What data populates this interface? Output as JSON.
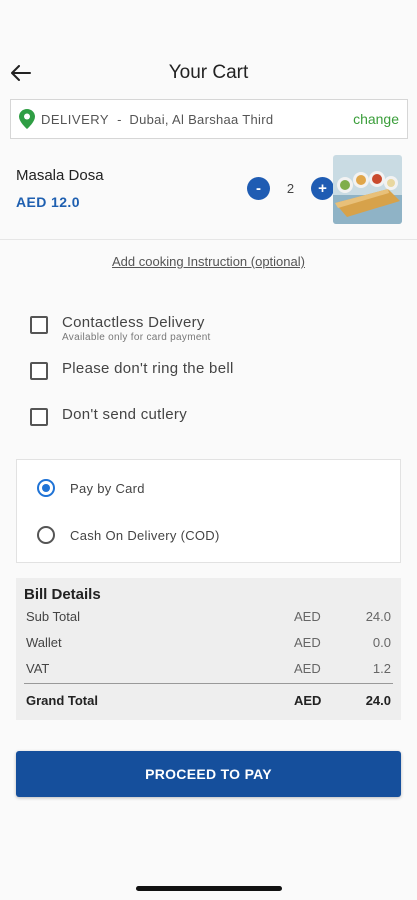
{
  "header": {
    "title": "Your Cart",
    "back_icon": "arrow-left-icon"
  },
  "address": {
    "type": "DELIVERY",
    "separator": "-",
    "location": "Dubai, Al Barshaa Third",
    "change_label": "change",
    "pin_color": "#2f9e44"
  },
  "cart": {
    "items": [
      {
        "name": "Masala Dosa",
        "price": "AED 12.0",
        "minus": "-",
        "quantity": "2",
        "plus": "+"
      }
    ]
  },
  "instructions": {
    "label": "Add cooking Instruction (optional)"
  },
  "options": {
    "contactless": {
      "label": "Contactless Delivery",
      "sublabel": "Available only for card payment",
      "checked": false
    },
    "no_bell": {
      "label": "Please don't ring the bell",
      "checked": false
    },
    "no_cutlery": {
      "label": "Don't send cutlery",
      "checked": false
    }
  },
  "payment": {
    "options": [
      {
        "label": "Pay by Card",
        "selected": true
      },
      {
        "label": "Cash On Delivery (COD)",
        "selected": false
      }
    ]
  },
  "bill": {
    "title": "Bill Details",
    "rows": [
      {
        "label": "Sub Total",
        "currency": "AED",
        "amount": "24.0"
      },
      {
        "label": "Wallet",
        "currency": "AED",
        "amount": "0.0"
      },
      {
        "label": "VAT",
        "currency": "AED",
        "amount": "1.2"
      }
    ],
    "total": {
      "label": "Grand Total",
      "currency": "AED",
      "amount": "24.0"
    }
  },
  "actions": {
    "proceed_label": "PROCEED TO PAY"
  },
  "colors": {
    "accent": "#154f9c",
    "price": "#1e5fb0",
    "change": "#3a9e3a",
    "radio": "#1f73d6"
  }
}
